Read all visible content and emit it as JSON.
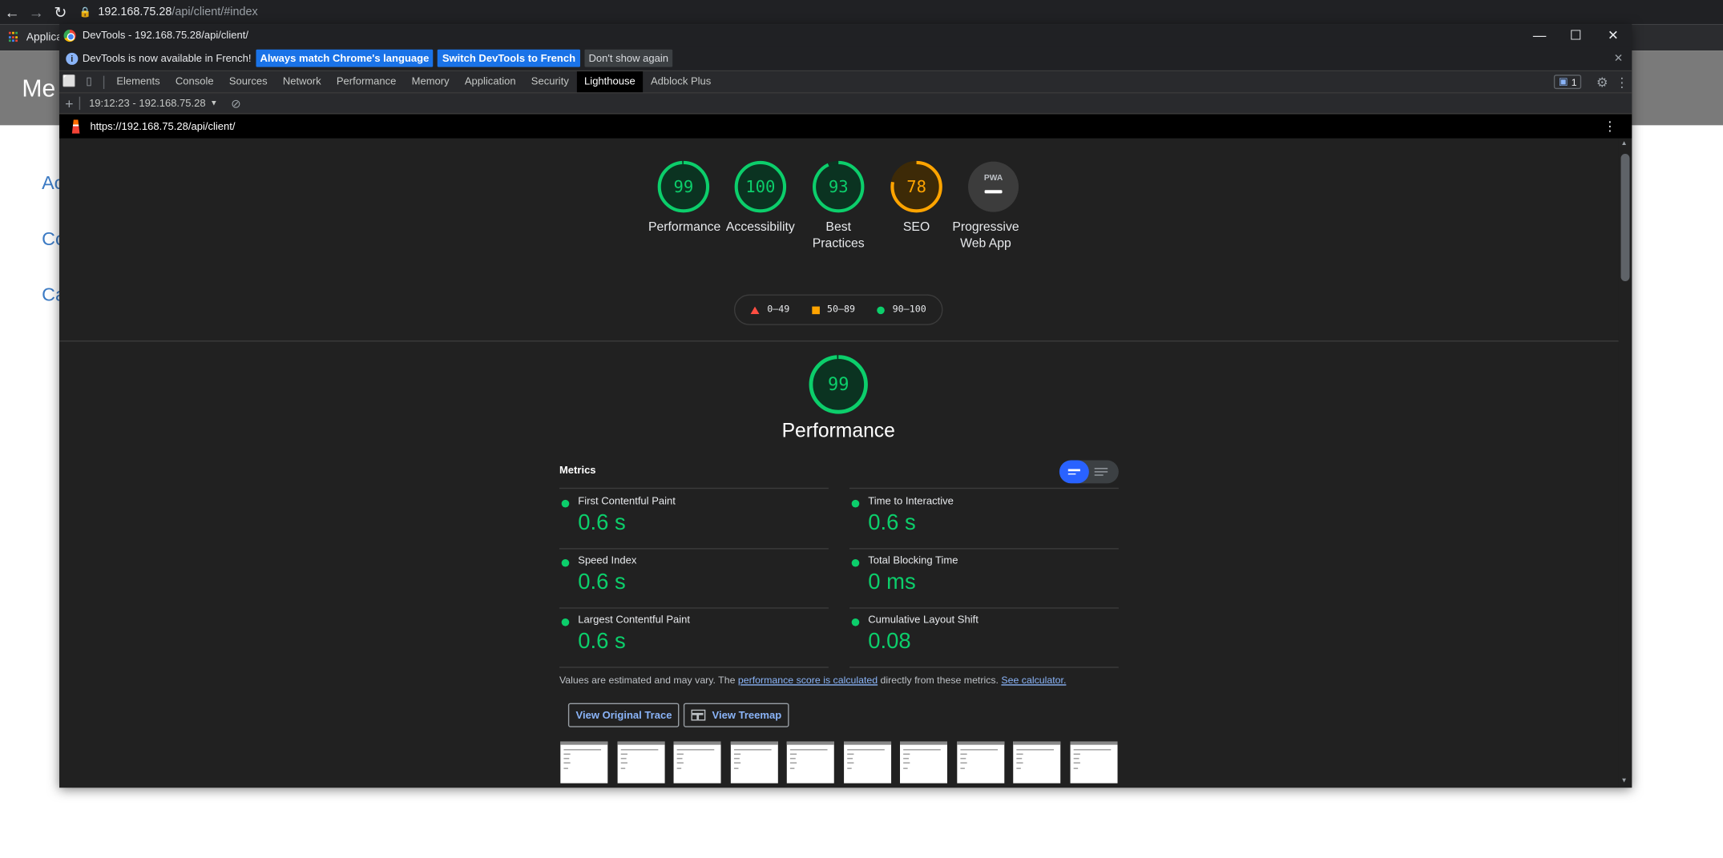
{
  "browser": {
    "url_host": "192.168.75.28",
    "url_path": "/api/client/#index",
    "bookmarks_label": "Applica"
  },
  "page": {
    "title": "Me",
    "links": [
      "Ac",
      "Co",
      "Ca"
    ]
  },
  "devtools": {
    "window_title": "DevTools - 192.168.75.28/api/client/",
    "infobar": {
      "message": "DevTools is now available in French!",
      "btn_match": "Always match Chrome's language",
      "btn_switch": "Switch DevTools to French",
      "btn_dismiss": "Don't show again"
    },
    "tabs": [
      "Elements",
      "Console",
      "Sources",
      "Network",
      "Performance",
      "Memory",
      "Application",
      "Security",
      "Lighthouse",
      "Adblock Plus"
    ],
    "active_tab": "Lighthouse",
    "issues_count": "1",
    "report_selector": "19:12:23 - 192.168.75.28",
    "report_url": "https://192.168.75.28/api/client/"
  },
  "lighthouse": {
    "gauges": [
      {
        "score": "99",
        "label": "Performance",
        "color": "#0cce6b"
      },
      {
        "score": "100",
        "label": "Accessibility",
        "color": "#0cce6b"
      },
      {
        "score": "93",
        "label": "Best Practices",
        "color": "#0cce6b"
      },
      {
        "score": "78",
        "label": "SEO",
        "color": "#ffa400"
      },
      {
        "score": "",
        "label": "Progressive Web App",
        "color": "#9aa0a6"
      }
    ],
    "pwa_badge": "PWA",
    "legend": [
      {
        "range": "0–49",
        "color": "#ff4e42",
        "shape": "triangle"
      },
      {
        "range": "50–89",
        "color": "#ffa400",
        "shape": "square"
      },
      {
        "range": "90–100",
        "color": "#0cce6b",
        "shape": "circle"
      }
    ],
    "main_gauge": {
      "score": "99",
      "label": "Performance"
    },
    "metrics_title": "Metrics",
    "metrics": [
      {
        "name": "First Contentful Paint",
        "value": "0.6 s"
      },
      {
        "name": "Time to Interactive",
        "value": "0.6 s"
      },
      {
        "name": "Speed Index",
        "value": "0.6 s"
      },
      {
        "name": "Total Blocking Time",
        "value": "0 ms"
      },
      {
        "name": "Largest Contentful Paint",
        "value": "0.6 s"
      },
      {
        "name": "Cumulative Layout Shift",
        "value": "0.08"
      }
    ],
    "note": {
      "before": "Values are estimated and may vary. The ",
      "link1": "performance score is calculated",
      "middle": " directly from these metrics. ",
      "link2": "See calculator."
    },
    "btn_trace": "View Original Trace",
    "btn_treemap": "View Treemap",
    "filmstrip_count": 10
  }
}
